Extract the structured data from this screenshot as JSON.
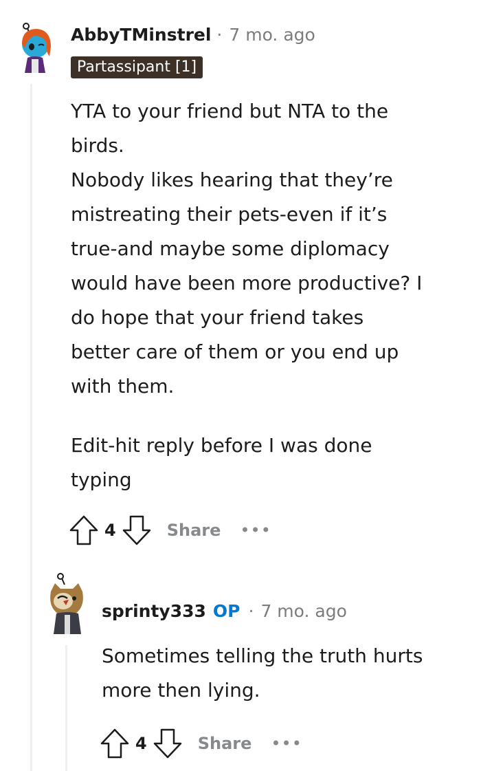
{
  "comment": {
    "username": "AbbyTMinstrel",
    "separator": "·",
    "time": "7 mo. ago",
    "flair": "Partassipant [1]",
    "paragraphs": [
      [
        "YTA to your friend but NTA to the",
        "birds.",
        "Nobody likes hearing that they’re",
        "mistreating their pets-even if it’s",
        "true-and maybe some diplomacy",
        "would have been more productive? I",
        "do hope that your friend takes",
        "better care of them or you end up",
        "with them."
      ],
      [
        "Edit-hit reply before I was done",
        "typing"
      ]
    ],
    "votes": "4",
    "share_label": "Share",
    "more_label": "•••"
  },
  "reply": {
    "username": "sprinty333",
    "op_badge": "OP",
    "separator": "·",
    "time": "7 mo. ago",
    "lines": [
      "Sometimes telling the truth hurts",
      "more then lying."
    ],
    "votes": "4",
    "share_label": "Share",
    "more_label": "•••"
  },
  "colors": {
    "accent": "#0079d3",
    "flair_bg": "#3d3027",
    "muted": "#878a8c",
    "thread_line": "#edeff1"
  }
}
